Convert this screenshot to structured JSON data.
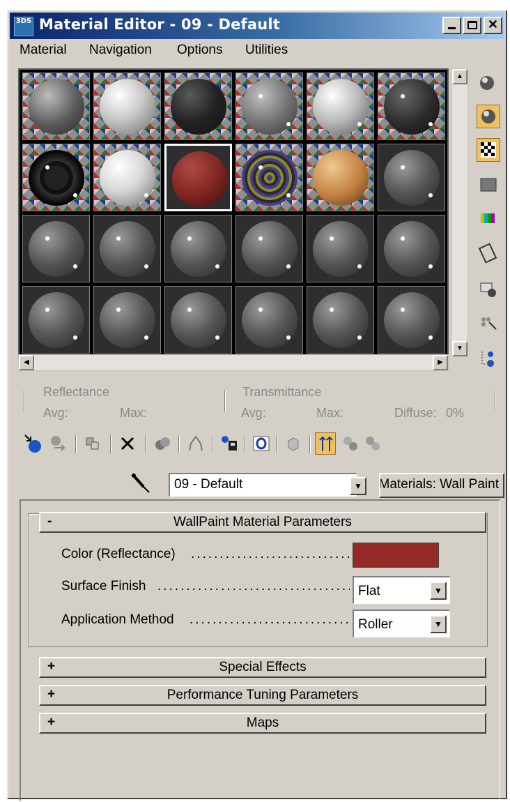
{
  "window": {
    "title": "Material Editor - 09 - Default",
    "app_icon_text": "3DS",
    "minimize_icon": "minimize-icon",
    "maximize_icon": "maximize-icon",
    "close_glyph": "✕"
  },
  "menu": [
    "Material",
    "Navigation",
    "Options",
    "Utilities"
  ],
  "sample_slots": {
    "active_index": 8,
    "rows": [
      [
        "gray-sphere",
        "white-sphere",
        "black-sphere",
        "granite-sphere",
        "light-sphere",
        "dark-sphere"
      ],
      [
        "rings-sphere",
        "glossy-white-sphere",
        "red-sphere",
        "pattern-sphere",
        "tan-tiles-sphere",
        "default-sphere"
      ],
      [
        "default-sphere",
        "default-sphere",
        "default-sphere",
        "default-sphere",
        "default-sphere",
        "default-sphere"
      ],
      [
        "default-sphere",
        "default-sphere",
        "default-sphere",
        "default-sphere",
        "default-sphere",
        "default-sphere"
      ]
    ]
  },
  "side_tools": [
    "sample-type-icon",
    "backlight-icon",
    "background-checker-icon",
    "sample-uv-tiling-icon",
    "video-color-check-icon",
    "make-preview-icon",
    "options-icon",
    "select-by-material-icon",
    "material-map-navigator-icon"
  ],
  "stats": {
    "reflectance": "Reflectance",
    "transmittance": "Transmittance",
    "avg": "Avg:",
    "max": "Max:",
    "diffuse": "Diffuse:",
    "diffuse_value": "0%"
  },
  "toolbar": [
    "get-material-icon",
    "put-to-scene-icon",
    "assign-to-selection-icon",
    "delete-icon",
    "make-unique-icon",
    "put-to-library-icon",
    "material-effects-icon",
    "show-map-icon",
    "show-end-result-icon",
    "go-to-parent-icon",
    "go-forward-icon",
    "go-to-sibling-icon"
  ],
  "material_name": "09 - Default",
  "material_type": "Materials: Wall Paint",
  "rollouts": {
    "main": {
      "sign": "-",
      "title": "WallPaint Material Parameters",
      "color_label": "Color (Reflectance)",
      "color_value": "#942a25",
      "finish_label": "Surface Finish",
      "finish_value": "Flat",
      "method_label": "Application Method",
      "method_value": "Roller"
    },
    "collapsed": [
      {
        "sign": "+",
        "title": "Special Effects"
      },
      {
        "sign": "+",
        "title": "Performance Tuning Parameters"
      },
      {
        "sign": "+",
        "title": "Maps"
      }
    ]
  }
}
